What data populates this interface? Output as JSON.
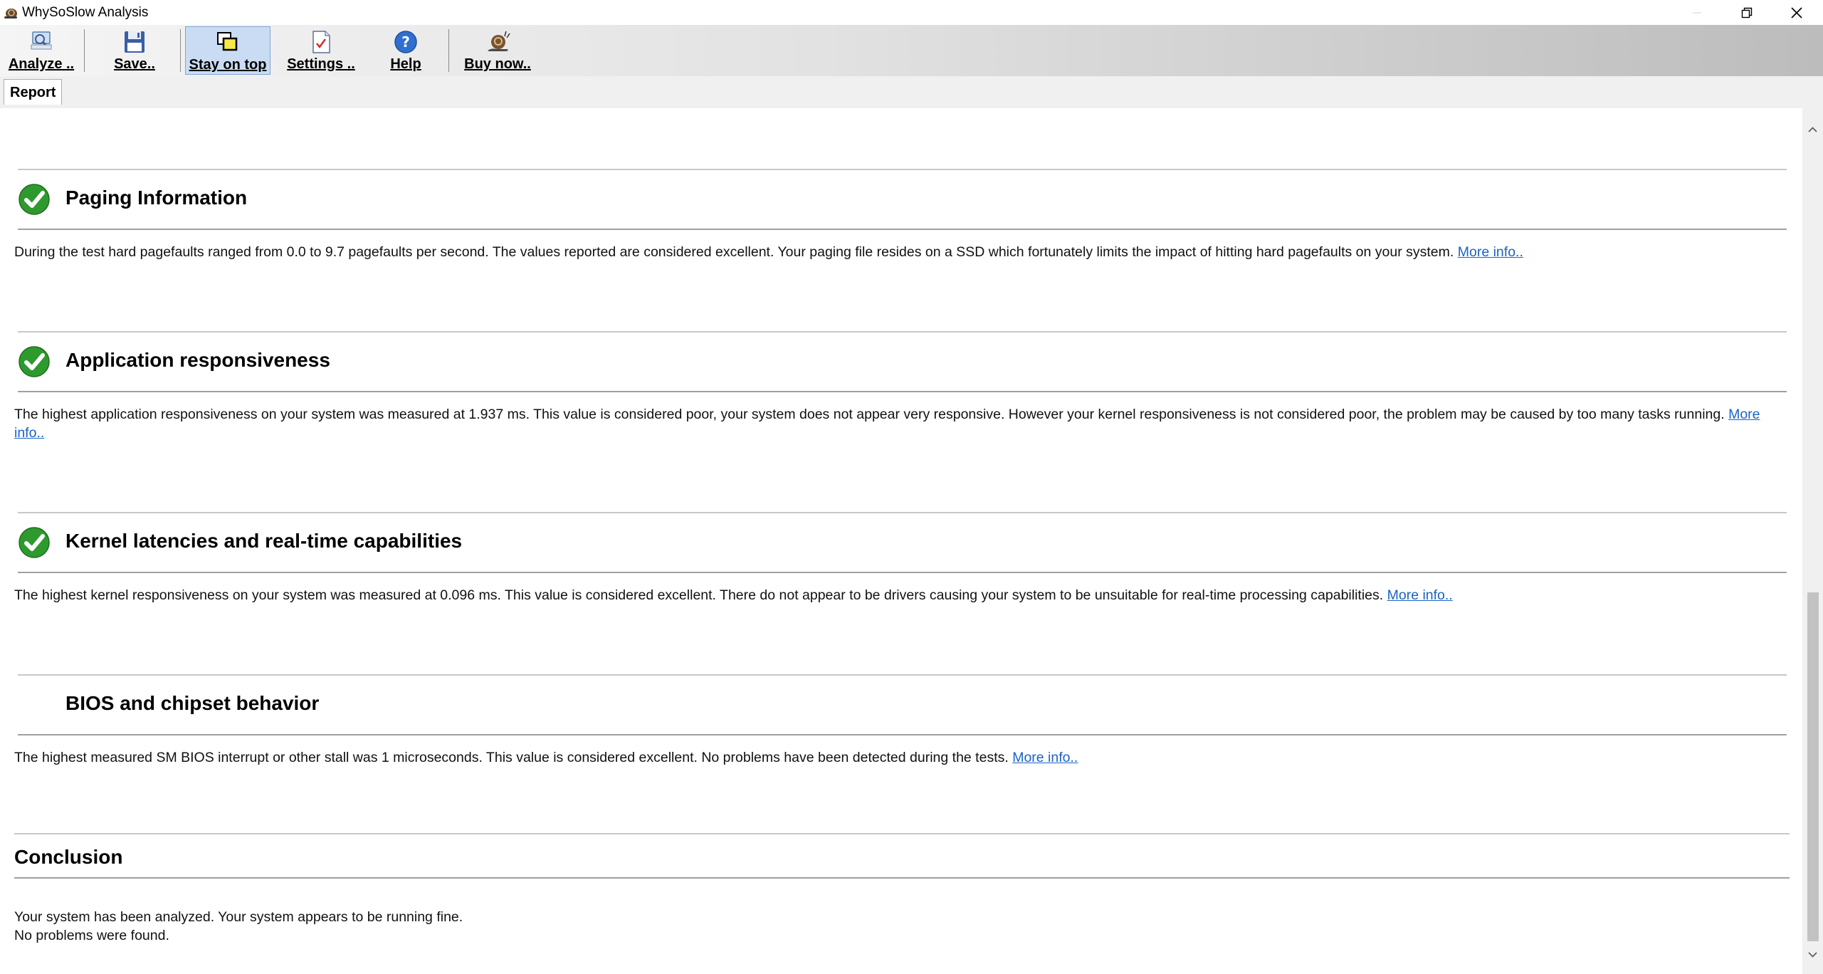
{
  "window": {
    "title": "WhySoSlow Analysis"
  },
  "toolbar": {
    "buttons": [
      {
        "label": "Analyze ..",
        "icon": "magnifier-icon"
      },
      {
        "label": "Save..",
        "icon": "floppy-disk-icon"
      },
      {
        "label": "Stay on top",
        "icon": "stacked-windows-icon",
        "active": true
      },
      {
        "label": "Settings ..",
        "icon": "checklist-icon"
      },
      {
        "label": "Help",
        "icon": "help-icon"
      },
      {
        "label": "Buy now..",
        "icon": "snail-icon"
      }
    ]
  },
  "tabs": {
    "report": "Report"
  },
  "sections": [
    {
      "title": "Paging Information",
      "text": "During the test hard pagefaults ranged from 0.0 to 9.7 pagefaults per second. The values reported are considered excellent. Your paging file resides on a SSD which fortunately limits the impact of hitting hard pagefaults on your system.",
      "link": "More info..",
      "status": "ok"
    },
    {
      "title": "Application responsiveness",
      "text": "The highest application responsiveness on your system was measured at 1.937 ms. This value is considered poor, your system does not appear very responsive. However your kernel responsiveness is not considered poor, the problem may be caused by too many tasks running.",
      "link": "More info..",
      "status": "ok"
    },
    {
      "title": "Kernel latencies and real-time capabilities",
      "text": "The highest kernel responsiveness on your system was measured at 0.096 ms. This value is considered excellent. There do not appear to be drivers causing your system to be unsuitable for real-time processing capabilities.",
      "link": "More info..",
      "status": "ok"
    },
    {
      "title": "BIOS and chipset behavior",
      "text": "The highest measured SM BIOS interrupt or other stall was 1 microseconds. This value is considered excellent. No problems have been detected during the tests.",
      "link": "More info..",
      "status": "none"
    }
  ],
  "conclusion": {
    "title": "Conclusion",
    "line1": "Your system has been analyzed. Your system appears to be running fine.",
    "line2": "No problems were found."
  },
  "colors": {
    "link": "#1a63c7",
    "check_green": "#2e9a2e",
    "active_button": "#c9dcf3"
  }
}
